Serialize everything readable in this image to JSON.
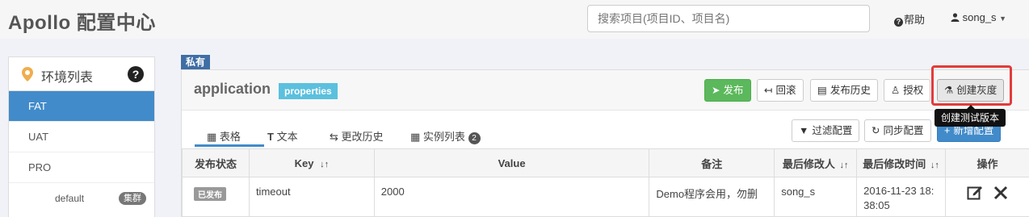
{
  "header": {
    "logo": "Apollo 配置中心",
    "search_placeholder": "搜索项目(项目ID、项目名)",
    "help": "帮助",
    "user": "song_s"
  },
  "sidebar": {
    "title": "环境列表",
    "help_glyph": "?",
    "envs": [
      "FAT",
      "UAT",
      "PRO"
    ],
    "active_env": "FAT",
    "cluster": {
      "name": "default",
      "badge": "集群"
    }
  },
  "namespace": {
    "tag": "私有",
    "name": "application",
    "format": "properties",
    "actions": {
      "publish": "发布",
      "rollback": "回滚",
      "history": "发布历史",
      "authorize": "授权",
      "gray": "创建灰度"
    },
    "tooltip": "创建测试版本",
    "tabs": {
      "table": "表格",
      "text": "文本",
      "change_history": "更改历史",
      "instances": "实例列表",
      "instance_count": "2"
    },
    "filter_button": "过滤配置",
    "sync_button": "同步配置",
    "add_button": "新增配置"
  },
  "table": {
    "headers": [
      "发布状态",
      "Key",
      "Value",
      "备注",
      "最后修改人",
      "最后修改时间",
      "操作"
    ],
    "sort_glyph": "↓↑",
    "rows": [
      {
        "status": "已发布",
        "key": "timeout",
        "value": "2000",
        "comment": "Demo程序会用，勿删",
        "modifier": "song_s",
        "time": "2016-11-23 18:38:05"
      }
    ]
  },
  "colors": {
    "primary": "#428bca",
    "success": "#5cb85c",
    "info": "#5bc0de",
    "highlight": "#e33b3b",
    "tag": "#3f6ea5"
  }
}
